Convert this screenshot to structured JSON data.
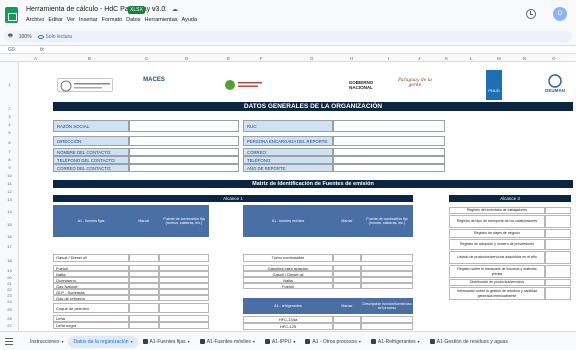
{
  "app": {
    "title": "Herramienta de cálculo - HdC Paraguay v3.0",
    "badge": "XLSX",
    "title_icons": "☆ ⛶ ☁",
    "menu": [
      "Archivo",
      "Editar",
      "Ver",
      "Insertar",
      "Formato",
      "Datos",
      "Herramientas",
      "Ayuda"
    ],
    "avatar_letter": "D"
  },
  "toolbar": {
    "zoom": "100%",
    "readonly_label": "Solo lectura"
  },
  "formula_bar": {
    "cell_ref": "G9",
    "fx": "fx"
  },
  "columns": [
    "A",
    "B",
    "C",
    "D",
    "E",
    "F",
    "G",
    "H",
    "I",
    "J",
    "K",
    "L",
    "M",
    "N",
    "O"
  ],
  "rows": [
    "1",
    "2",
    "3",
    "4",
    "5",
    "6",
    "7",
    "8",
    "9",
    "10",
    "11",
    "12",
    "13",
    "14",
    "15",
    "16",
    "17",
    "18",
    "19",
    "20",
    "21",
    "22",
    "23",
    "24",
    "25",
    "26",
    "27"
  ],
  "logos": {
    "maces": "MACES",
    "gobierno": "GOBIERNO NACIONAL",
    "paraguay": "Paraguay de la gente",
    "undp": "PNUD",
    "deuman": "DEUMAN"
  },
  "general": {
    "title": "DATOS GENERALES DE LA ORGANIZACIÓN",
    "left_labels": [
      "RAZÓN SOCIAL:",
      "DIRECCIÓN:",
      "NOMBRE DEL CONTACTO:",
      "TELÉFONO DEL CONTACTO:",
      "CORREO DEL CONTACTO:"
    ],
    "right_labels": [
      "RUC:",
      "PERSONA ENCARGADA DEL REPORTE:",
      "CORREO:",
      "TELÉFONO:",
      "AÑO DE REPORTE:"
    ]
  },
  "matrix": {
    "title": "Matriz de Identificación de Fuentes de emisión",
    "alcance1": "Alcance 1",
    "alcance3": "Alcance 3",
    "a1_fijas_header": "A1 - fuentes fijas",
    "a1_moviles_header": "A1 - fuentes móviles",
    "marcar": "Marcar",
    "fuente_comb": "Fuente de combustión fija (hornos, calderas, etc.)",
    "fuente_comb_mov": "Fuente de combustión fija (hornos, calderas, etc.)",
    "fijas_items": [
      "Gasoil / Diesel oil",
      "Fueloil",
      "Nafta",
      "Queroseno",
      "Gas Natural",
      "GLP - Supergás",
      "Gas de refinería",
      "Coque de petróleo",
      "Leña",
      "Leña negra"
    ],
    "moviles_items": [
      "Turbo combustible",
      "Gasolina para aviación",
      "Gasoil / Diesel oil",
      "Nafta",
      "Fueloil"
    ],
    "refrig_header": "A1 - refrigerantes",
    "refrig_desc": "Descripción función/fuente/uso del proceso",
    "refrig_items": [
      "HFC-134a",
      "HFC-125"
    ],
    "a3_items": [
      "Registro del inventario de trabajadores",
      "Registro del tipo de transporte de los colaboradores",
      "Registro de viajes de negocio",
      "Registro de adopción y número de proveedores",
      "Listado de productos/servicios adquiridos en el año",
      "Registro sobre el transporte de insumos y materias primas",
      "Distribución de productos/servicios",
      "Información sobre la gestión de residuos y cantidad generada mensualmente"
    ]
  },
  "tabs": {
    "items": [
      {
        "label": "Instrucciones",
        "active": false,
        "icon": false
      },
      {
        "label": "Datos de la organización",
        "active": true,
        "icon": false
      },
      {
        "label": "A1-Fuentes fijas",
        "active": false,
        "icon": true
      },
      {
        "label": "A1-Fuentes móviles",
        "active": false,
        "icon": true
      },
      {
        "label": "A1-IPPU",
        "active": false,
        "icon": true
      },
      {
        "label": "A1 - Otros procesos",
        "active": false,
        "icon": true
      },
      {
        "label": "A1-Refrigerantes",
        "active": false,
        "icon": true
      },
      {
        "label": "A1-Gestión de residuos y aguas",
        "active": false,
        "icon": true
      }
    ]
  },
  "colors": {
    "navy": "#0b2545",
    "label_fill": "#cfe2f3",
    "header_blue": "#4a6fa5",
    "accent": "#1a73e8",
    "brand_green": "#0f9d58"
  }
}
